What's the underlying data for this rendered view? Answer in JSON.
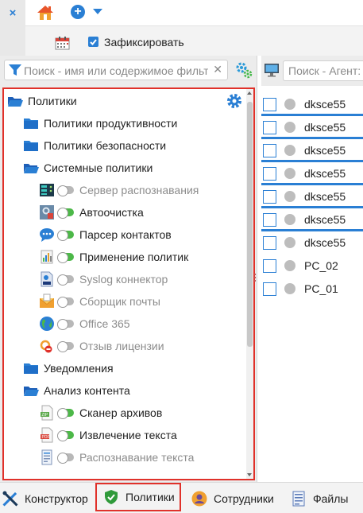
{
  "topbar": {
    "close_icon": "×",
    "home_icon": "home-icon",
    "add_icon": "+",
    "add_caret_icon": "caret-down-icon"
  },
  "toolbar": {
    "calendar_icon": "calendar-icon",
    "pin_checked": true,
    "pin_label": "Зафиксировать"
  },
  "filter": {
    "placeholder": "Поиск - имя или содержимое фильтра",
    "clear_icon": "✕"
  },
  "tree": {
    "root": {
      "label": "Политики",
      "icon": "folder-open-icon"
    },
    "items": [
      {
        "label": "Политики продуктивности",
        "icon": "folder-icon"
      },
      {
        "label": "Политики безопасности",
        "icon": "folder-icon"
      },
      {
        "label": "Системные политики",
        "icon": "folder-open-icon"
      },
      {
        "label": "Сервер распознавания",
        "icon": "server-icon",
        "enabled": false
      },
      {
        "label": "Автоочистка",
        "icon": "broom-icon",
        "enabled": true
      },
      {
        "label": "Парсер контактов",
        "icon": "chat-icon",
        "enabled": true
      },
      {
        "label": "Применение политик",
        "icon": "policy-chart-icon",
        "enabled": true
      },
      {
        "label": "Syslog коннектор",
        "icon": "log-file-icon",
        "enabled": false
      },
      {
        "label": "Сборщик почты",
        "icon": "mail-icon",
        "enabled": false
      },
      {
        "label": "Office 365",
        "icon": "globe-icon",
        "enabled": false
      },
      {
        "label": "Отзыв лицензии",
        "icon": "license-revoke-icon",
        "enabled": false
      },
      {
        "label": "Уведомления",
        "icon": "folder-icon"
      },
      {
        "label": "Анализ контента",
        "icon": "folder-open-icon"
      },
      {
        "label": "Сканер архивов",
        "icon": "zip-icon",
        "enabled": true
      },
      {
        "label": "Извлечение текста",
        "icon": "pdf-icon",
        "enabled": true
      },
      {
        "label": "Распознавание текста",
        "icon": "document-icon",
        "enabled": false
      }
    ]
  },
  "agents": {
    "search_placeholder": "Поиск - Агент: имя",
    "rows": [
      {
        "name": "dksce55"
      },
      {
        "name": "dksce55"
      },
      {
        "name": "dksce55"
      },
      {
        "name": "dksce55"
      },
      {
        "name": "dksce55"
      },
      {
        "name": "dksce55"
      },
      {
        "name": "dksce55"
      },
      {
        "name": "PC_02"
      },
      {
        "name": "PC_01"
      }
    ]
  },
  "bottom_tabs": [
    {
      "label": "Конструктор",
      "icon": "tools-icon",
      "active": false
    },
    {
      "label": "Политики",
      "icon": "shield-icon",
      "active": true
    },
    {
      "label": "Сотрудники",
      "icon": "user-icon",
      "active": false
    },
    {
      "label": "Файлы",
      "icon": "file-list-icon",
      "active": false
    }
  ],
  "colors": {
    "accent": "#2a7fd4",
    "highlight": "#e0312a",
    "toggle_on": "#4cb848",
    "toggle_off": "#b8b8b8"
  }
}
